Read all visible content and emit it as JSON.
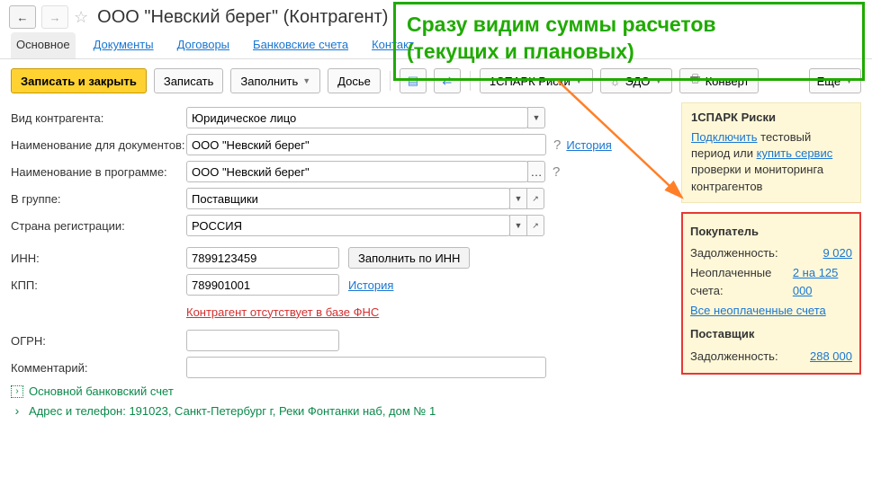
{
  "nav": {
    "back": "←",
    "fwd": "→",
    "star": "☆"
  },
  "title": "ООО \"Невский берег\" (Контрагент)",
  "tabs": {
    "main": "Основное",
    "docs": "Документы",
    "contr": "Договоры",
    "bank": "Банковские счета",
    "contact": "Контакт"
  },
  "toolbar": {
    "save_close": "Записать и закрыть",
    "save": "Записать",
    "fill": "Заполнить",
    "dossier": "Досье",
    "spark": "1СПАРК Риски",
    "edo": "ЭДО",
    "envelope": "Конверт",
    "more": "Еще"
  },
  "annotation": {
    "l1": "Сразу видим суммы расчетов",
    "l2": "(текущих и плановых)"
  },
  "form": {
    "kind_label": "Вид контрагента:",
    "kind_value": "Юридическое лицо",
    "docname_label": "Наименование для документов:",
    "docname_value": "ООО \"Невский берег\"",
    "history": "История",
    "progname_label": "Наименование в программе:",
    "progname_value": "ООО \"Невский берег\"",
    "group_label": "В группе:",
    "group_value": "Поставщики",
    "country_label": "Страна регистрации:",
    "country_value": "РОССИЯ",
    "inn_label": "ИНН:",
    "inn_value": "7899123459",
    "inn_btn": "Заполнить по ИНН",
    "kpp_label": "КПП:",
    "kpp_value": "789901001",
    "missing": "Контрагент отсутствует в базе ФНС",
    "ogrn_label": "ОГРН:",
    "ogrn_value": "",
    "comment_label": "Комментарий:",
    "comment_value": "",
    "bank_expand": "Основной банковский счет",
    "addr_expand": "Адрес и телефон: 191023, Санкт-Петербург г, Реки Фонтанки наб, дом № 1"
  },
  "spark_panel": {
    "title": "1СПАРК Риски",
    "link1": "Подключить",
    "t1": " тестовый период или ",
    "link2": "купить сервис",
    "t2": " проверки и мониторинга контрагентов"
  },
  "red": {
    "buyer": "Покупатель",
    "debt_label": "Задолженность:",
    "debt_val": "9 020",
    "unpaid_label": "Неоплаченные счета:",
    "unpaid_val": "2 на 125 000",
    "all_unpaid": "Все неоплаченные счета",
    "supplier": "Поставщик",
    "sup_debt_label": "Задолженность:",
    "sup_debt_val": "288 000"
  }
}
